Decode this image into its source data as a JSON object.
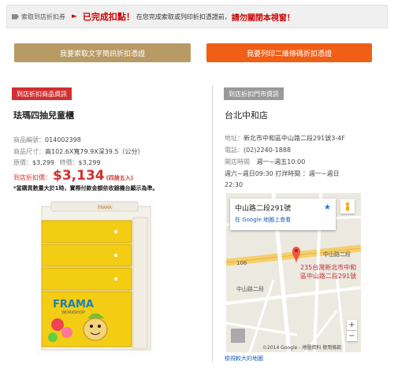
{
  "topbar": {
    "crumb_label": "索取到店折扣券",
    "done_label": "已完成扣點！",
    "note": "在您完成索取或列印折扣憑證前，",
    "close_note": "請勿關閉本視窗！"
  },
  "buttons": {
    "text_coupon": "我要索取文字簡訊折扣憑證",
    "qr_coupon": "我要列印二維條碼折扣憑證"
  },
  "product": {
    "section_label": "到店折扣商品資訊",
    "title": "珐瑪四抽兒童櫃",
    "id_label": "商品編號：",
    "id_value": "014002398",
    "size_label": "商品尺寸：",
    "size_value": "高102.6X寬79.9X深39.5（公分）",
    "price_label": "原價：",
    "original_price": "$3,299",
    "special_label": "特價：",
    "special_price": "$3,299",
    "store_price_label": "到店折扣價：",
    "store_price": "$3,134",
    "rounding": "(四捨五入)",
    "warning": "*當購買數量大於1時，實際付款金額依收銀機台顯示為準。",
    "drawer_brand": "FRAMA",
    "drawer_sub": "WORKSHOP"
  },
  "store": {
    "section_label": "到店折扣門市資訊",
    "name": "台北中和店",
    "address_label": "地址：",
    "address": "新北市中和區中山路二段291號3-4F",
    "phone_label": "電話：",
    "phone": "(02)2240-1888",
    "hours_label": "開店時間",
    "hours_1": "週一~週五10:00",
    "hours_2": "週六~週日09:30  打烊時間  ：週一~週日",
    "hours_3": "22:30"
  },
  "map": {
    "card_title": "中山路二段291號",
    "card_link": "在 Google 地圖上查看",
    "address_line1": "235台灣新北市中和",
    "address_line2": "區中山路二段291號",
    "road_1": "中山路二段",
    "road_2": "中山路二段",
    "road_3": "106",
    "copyright": "©2014 Google - 地圖資料    使用條款",
    "larger_map_link": "檢視較大的地圖"
  },
  "colors": {
    "accent_red": "#d32f2f",
    "button_tan": "#b89a64",
    "button_orange": "#f05f16"
  }
}
